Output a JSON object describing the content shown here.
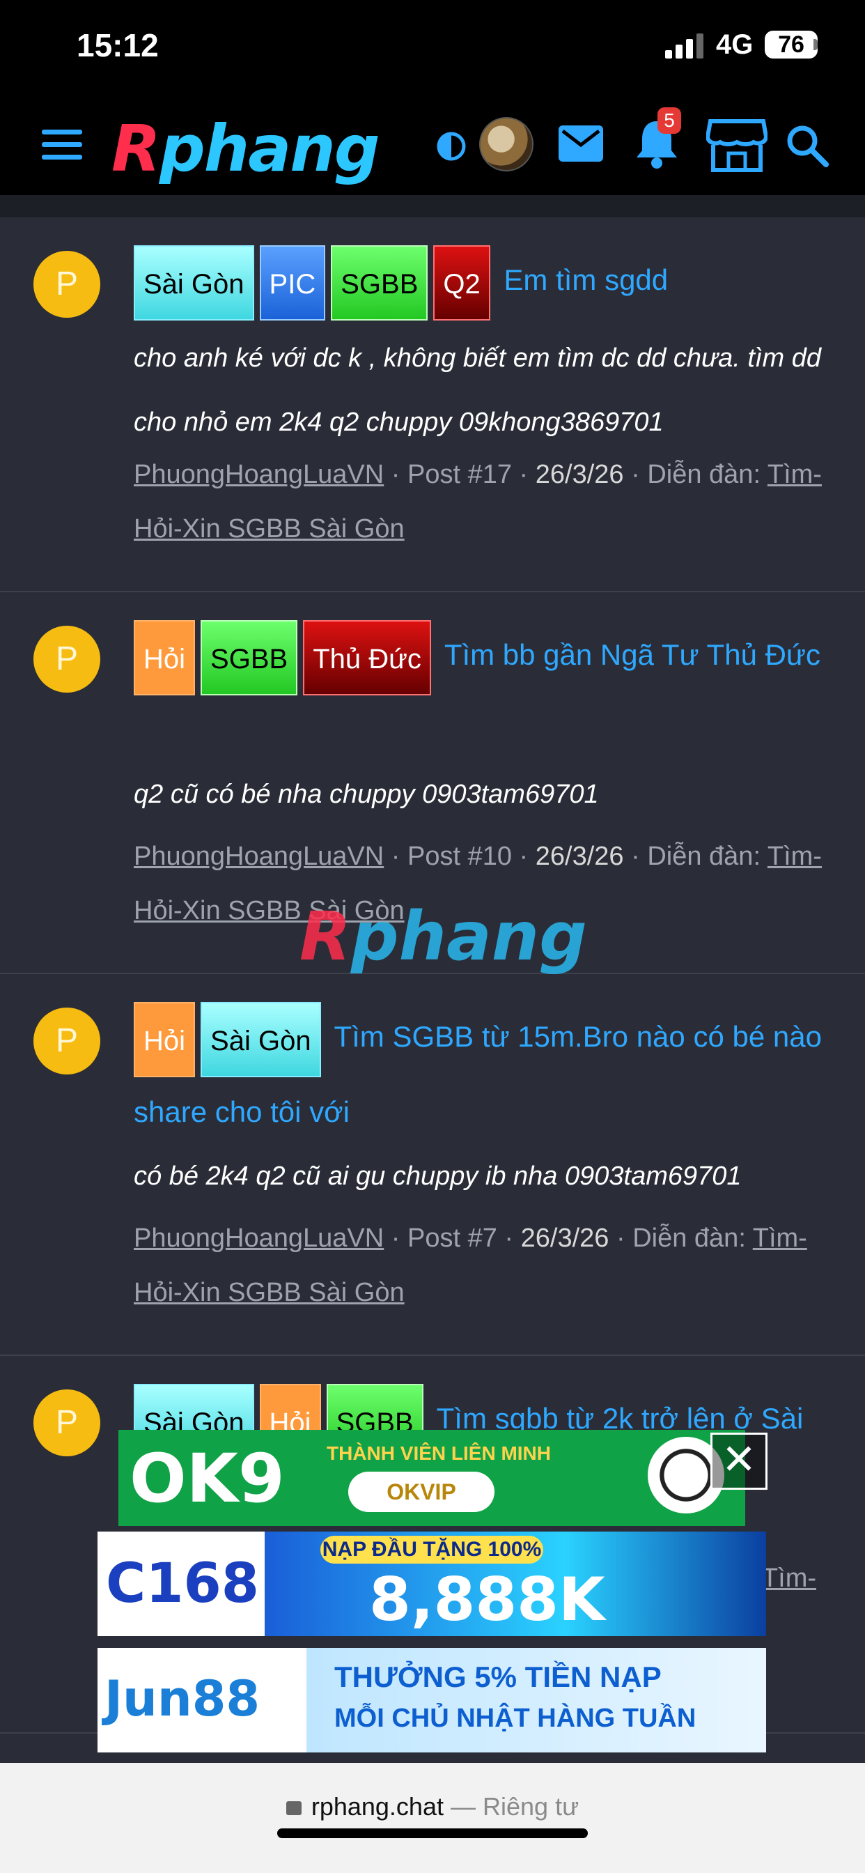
{
  "status_bar": {
    "time": "15:12",
    "network": "4G",
    "battery": "76"
  },
  "header": {
    "logo_part1": "R",
    "logo_part2": "phang",
    "notification_count": "5"
  },
  "threads": [
    {
      "avatar_letter": "P",
      "tags": [
        "Sài Gòn",
        "PIC",
        "SGBB",
        "Q2"
      ],
      "title": "Em tìm sgdd",
      "snippet": "cho anh ké với dc k , không biết em tìm dc dd chưa. tìm dd cho nhỏ em 2k4 q2 chuppy 09khong3869701",
      "author": "PhuongHoangLuaVN",
      "post": "Post #17",
      "date": "26/3/26",
      "forum_label": "Diễn đàn:",
      "forum": "Tìm-Hỏi-Xin SGBB Sài Gòn"
    },
    {
      "avatar_letter": "P",
      "tags": [
        "Hỏi",
        "SGBB",
        "Thủ Đức"
      ],
      "title": "Tìm bb gần Ngã Tư Thủ Đức",
      "snippet": "q2 cũ có bé nha chuppy 0903tam69701",
      "author": "PhuongHoangLuaVN",
      "post": "Post #10",
      "date": "26/3/26",
      "forum_label": "Diễn đàn:",
      "forum": "Tìm-Hỏi-Xin SGBB Sài Gòn"
    },
    {
      "avatar_letter": "P",
      "tags": [
        "Hỏi",
        "Sài Gòn"
      ],
      "title": "Tìm SGBB từ 15m.Bro nào có bé nào share cho tôi với",
      "snippet": "có bé 2k4 q2 cũ ai gu chuppy ib nha 0903tam69701",
      "author": "PhuongHoangLuaVN",
      "post": "Post #7",
      "date": "26/3/26",
      "forum_label": "Diễn đàn:",
      "forum": "Tìm-Hỏi-Xin SGBB Sài Gòn"
    },
    {
      "avatar_letter": "P",
      "tags": [
        "Sài Gòn",
        "Hỏi",
        "SGBB"
      ],
      "title": "Tìm sgbb từ 2k trở lên ở Sài",
      "forum_tail": "Tìm-"
    }
  ],
  "watermark": {
    "part1": "R",
    "part2": "phang"
  },
  "ads": {
    "ok9": {
      "brand": "OK9",
      "slogan": "THÀNH VIÊN LIÊN MINH",
      "badge": "OKVIP"
    },
    "c168": {
      "brand": "C168",
      "top": "NẠP ĐẦU TẶNG 100%",
      "amount": "8,888K"
    },
    "jun88": {
      "brand": "Jun88",
      "line1": "THƯỞNG 5% TIỀN NẠP",
      "line2": "MỖI CHỦ NHẬT HÀNG TUẦN"
    },
    "close": "✕"
  },
  "browser": {
    "domain": "rphang.chat",
    "separator": " — ",
    "privacy": "Riêng tư"
  },
  "colors": {
    "link": "#2fa8ff",
    "avatar": "#f7bc12",
    "background": "#2a2d37"
  }
}
